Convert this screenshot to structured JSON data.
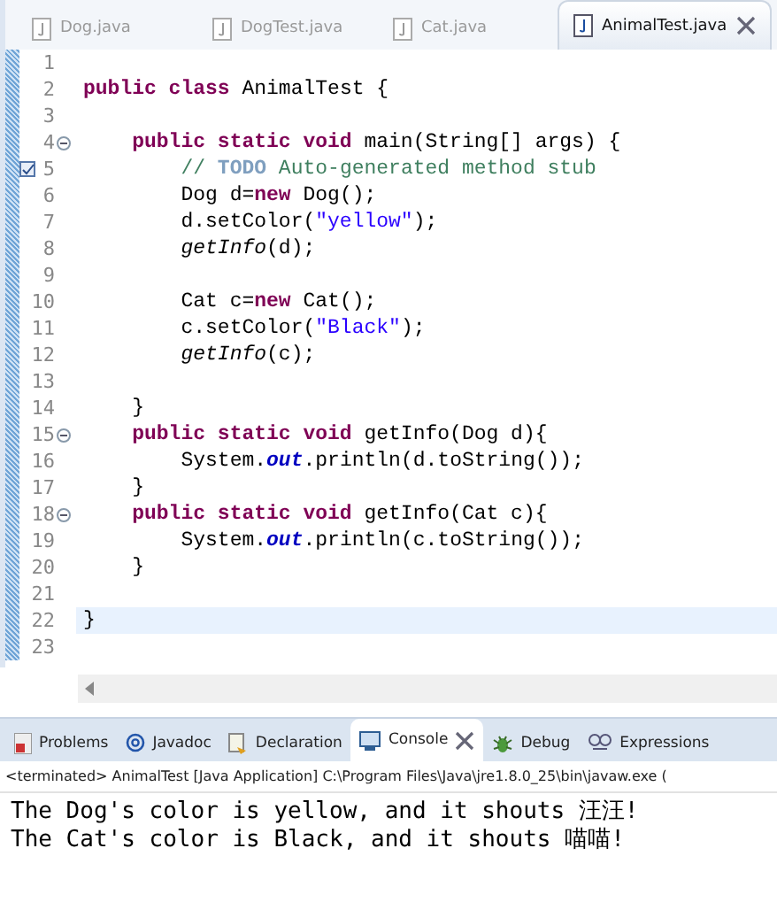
{
  "editor_tabs": [
    {
      "label": "Dog.java",
      "selected": false
    },
    {
      "label": "DogTest.java",
      "selected": false
    },
    {
      "label": "Cat.java",
      "selected": false
    },
    {
      "label": "AnimalTest.java",
      "selected": true
    }
  ],
  "code_lines": [
    {
      "number": "1",
      "fold": false,
      "task": false,
      "current": false
    },
    {
      "number": "2",
      "fold": false,
      "task": false,
      "current": false,
      "tokens": [
        {
          "kind": "keyword",
          "text": "public class"
        },
        {
          "kind": "plain",
          "text": " AnimalTest {"
        }
      ]
    },
    {
      "number": "3",
      "fold": false,
      "task": false,
      "current": false
    },
    {
      "number": "4",
      "fold": true,
      "task": false,
      "current": false,
      "tokens": [
        {
          "kind": "keyword",
          "text": "    public static void"
        },
        {
          "kind": "plain",
          "text": " main(String[] args) {"
        }
      ]
    },
    {
      "number": "5",
      "fold": false,
      "task": true,
      "current": false,
      "tokens": [
        {
          "kind": "comment",
          "text": "        // "
        },
        {
          "kind": "todo",
          "text": "TODO"
        },
        {
          "kind": "comment",
          "text": " Auto-generated method stub"
        }
      ]
    },
    {
      "number": "6",
      "fold": false,
      "task": false,
      "current": false,
      "tokens": [
        {
          "kind": "plain",
          "text": "        Dog d="
        },
        {
          "kind": "keyword",
          "text": "new"
        },
        {
          "kind": "plain",
          "text": " Dog();"
        }
      ]
    },
    {
      "number": "7",
      "fold": false,
      "task": false,
      "current": false,
      "tokens": [
        {
          "kind": "plain",
          "text": "        d.setColor("
        },
        {
          "kind": "string",
          "text": "\"yellow\""
        },
        {
          "kind": "plain",
          "text": ");"
        }
      ]
    },
    {
      "number": "8",
      "fold": false,
      "task": false,
      "current": false,
      "tokens": [
        {
          "kind": "static-call",
          "text": "        getInfo"
        },
        {
          "kind": "plain",
          "text": "(d);"
        }
      ]
    },
    {
      "number": "9",
      "fold": false,
      "task": false,
      "current": false
    },
    {
      "number": "10",
      "fold": false,
      "task": false,
      "current": false,
      "tokens": [
        {
          "kind": "plain",
          "text": "        Cat c="
        },
        {
          "kind": "keyword",
          "text": "new"
        },
        {
          "kind": "plain",
          "text": " Cat();"
        }
      ]
    },
    {
      "number": "11",
      "fold": false,
      "task": false,
      "current": false,
      "tokens": [
        {
          "kind": "plain",
          "text": "        c.setColor("
        },
        {
          "kind": "string",
          "text": "\"Black\""
        },
        {
          "kind": "plain",
          "text": ");"
        }
      ]
    },
    {
      "number": "12",
      "fold": false,
      "task": false,
      "current": false,
      "tokens": [
        {
          "kind": "static-call",
          "text": "        getInfo"
        },
        {
          "kind": "plain",
          "text": "(c);"
        }
      ]
    },
    {
      "number": "13",
      "fold": false,
      "task": false,
      "current": false
    },
    {
      "number": "14",
      "fold": false,
      "task": false,
      "current": false,
      "tokens": [
        {
          "kind": "plain",
          "text": "    }"
        }
      ]
    },
    {
      "number": "15",
      "fold": true,
      "task": false,
      "current": false,
      "tokens": [
        {
          "kind": "keyword",
          "text": "    public static void"
        },
        {
          "kind": "plain",
          "text": " getInfo(Dog d){"
        }
      ]
    },
    {
      "number": "16",
      "fold": false,
      "task": false,
      "current": false,
      "tokens": [
        {
          "kind": "plain",
          "text": "        System."
        },
        {
          "kind": "static-field",
          "text": "out"
        },
        {
          "kind": "plain",
          "text": ".println(d.toString());"
        }
      ]
    },
    {
      "number": "17",
      "fold": false,
      "task": false,
      "current": false,
      "tokens": [
        {
          "kind": "plain",
          "text": "    }"
        }
      ]
    },
    {
      "number": "18",
      "fold": true,
      "task": false,
      "current": false,
      "tokens": [
        {
          "kind": "keyword",
          "text": "    public static void"
        },
        {
          "kind": "plain",
          "text": " getInfo(Cat c){"
        }
      ]
    },
    {
      "number": "19",
      "fold": false,
      "task": false,
      "current": false,
      "tokens": [
        {
          "kind": "plain",
          "text": "        System."
        },
        {
          "kind": "static-field",
          "text": "out"
        },
        {
          "kind": "plain",
          "text": ".println(c.toString());"
        }
      ]
    },
    {
      "number": "20",
      "fold": false,
      "task": false,
      "current": false,
      "tokens": [
        {
          "kind": "plain",
          "text": "    }"
        }
      ]
    },
    {
      "number": "21",
      "fold": false,
      "task": false,
      "current": false
    },
    {
      "number": "22",
      "fold": false,
      "task": false,
      "current": true,
      "tokens": [
        {
          "kind": "plain",
          "text": "}"
        }
      ]
    },
    {
      "number": "23",
      "fold": false,
      "task": false,
      "current": false
    }
  ],
  "view_tabs": [
    {
      "label": "Problems",
      "selected": false
    },
    {
      "label": "Javadoc",
      "selected": false
    },
    {
      "label": "Declaration",
      "selected": false
    },
    {
      "label": "Console",
      "selected": true
    },
    {
      "label": "Debug",
      "selected": false
    },
    {
      "label": "Expressions",
      "selected": false
    }
  ],
  "console": {
    "status": "<terminated> AnimalTest [Java Application] C:\\Program Files\\Java\\jre1.8.0_25\\bin\\javaw.exe (",
    "output": [
      "The Dog's color is yellow, and it shouts 汪汪!",
      "The Cat's color is Black, and it shouts 喵喵!"
    ]
  }
}
